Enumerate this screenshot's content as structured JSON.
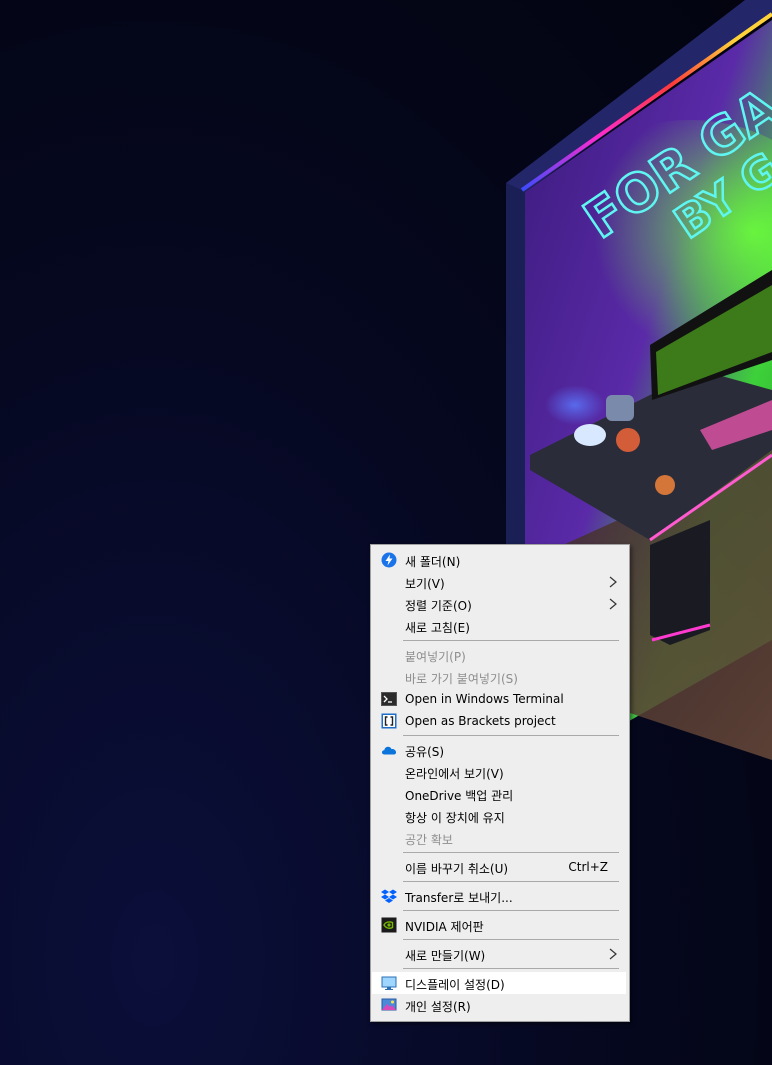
{
  "wallpaper": {
    "neon_line1": "FOR GA",
    "neon_line2": "BY G"
  },
  "menu": {
    "new_folder": "새 폴더(N)",
    "view": "보기(V)",
    "sort_by": "정렬 기준(O)",
    "refresh": "새로 고침(E)",
    "paste": "붙여넣기(P)",
    "paste_shortcut": "바로 가기 붙여넣기(S)",
    "open_terminal": "Open in Windows Terminal",
    "open_brackets": "Open as Brackets project",
    "share": "공유(S)",
    "view_online": "온라인에서 보기(V)",
    "onedrive_backup": "OneDrive 백업 관리",
    "always_keep": "항상 이 장치에 유지",
    "free_space": "공간 확보",
    "undo_rename": "이름 바꾸기 취소(U)",
    "undo_rename_shortcut": "Ctrl+Z",
    "transfer": "Transfer로 보내기...",
    "nvidia": "NVIDIA 제어판",
    "new": "새로 만들기(W)",
    "display_settings": "디스플레이 설정(D)",
    "personalize": "개인 설정(R)"
  },
  "icons": {
    "new_folder": "lightning-circle-icon",
    "terminal": "terminal-icon",
    "brackets": "brackets-icon",
    "share": "onedrive-cloud-icon",
    "transfer": "dropbox-icon",
    "nvidia": "nvidia-icon",
    "display": "monitor-icon",
    "personalize": "personalize-icon"
  },
  "colors": {
    "menu_bg": "#eeeeee",
    "highlight": "#ffffff",
    "disabled_text": "#8e8e8e",
    "neon_cyan": "#5ff6f2"
  }
}
